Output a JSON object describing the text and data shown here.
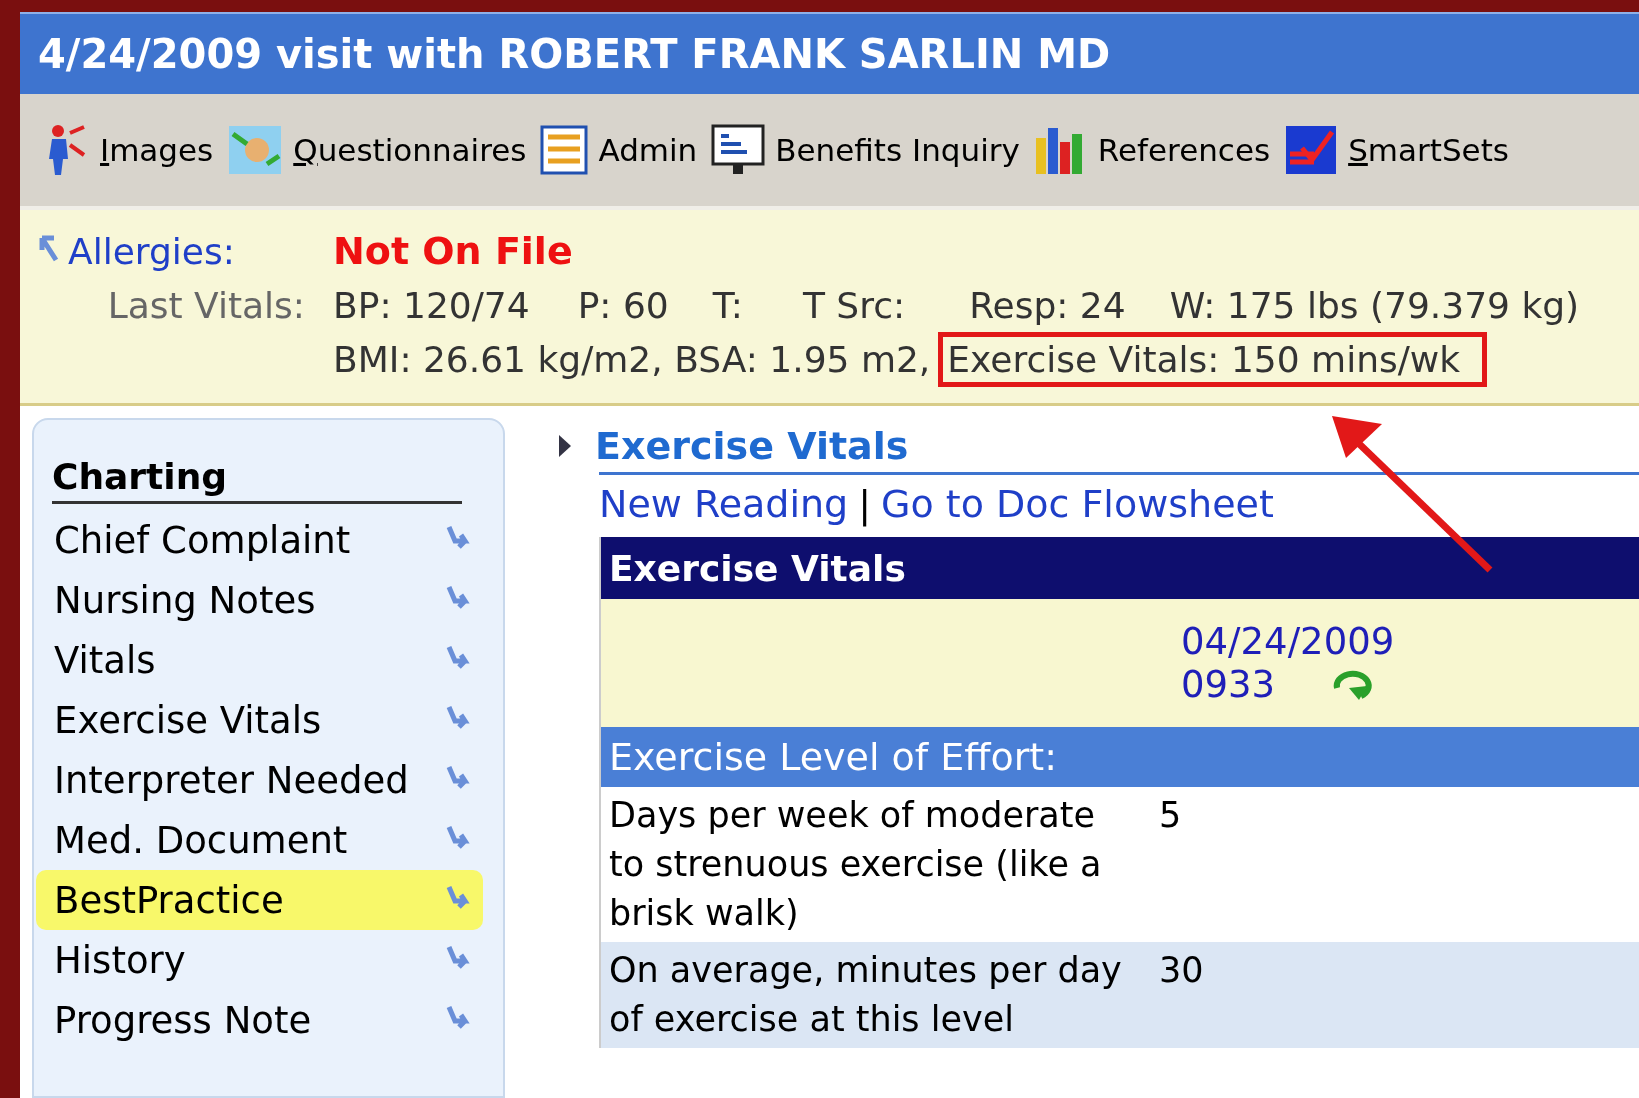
{
  "window": {
    "title": "4/24/2009 visit with ROBERT FRANK SARLIN MD"
  },
  "toolbar": [
    {
      "label": "Images",
      "kind": "person",
      "mnemonic": true
    },
    {
      "label": "Questionnaires",
      "kind": "form",
      "mnemonic": true
    },
    {
      "label": "Admin",
      "kind": "list",
      "mnemonic": false
    },
    {
      "label": "Benefits Inquiry",
      "kind": "monitor",
      "mnemonic": false
    },
    {
      "label": "References",
      "kind": "books",
      "mnemonic": false
    },
    {
      "label": "SmartSets",
      "kind": "check",
      "mnemonic": true
    }
  ],
  "header": {
    "allergies_label": "Allergies:",
    "allergies_value": "Not On File",
    "vitals_label": "Last Vitals:",
    "vitals": [
      "BP: 120/74",
      "P: 60",
      "T:",
      "T Src:",
      "Resp: 24",
      "W: 175 lbs (79.379 kg)"
    ],
    "vitals_line2": "BMI: 26.61 kg/m2, BSA: 1.95 m2,",
    "highlighted": "Exercise Vitals: 150 mins/wk"
  },
  "sidebar": {
    "heading": "Charting",
    "items": [
      {
        "label": "Chief Complaint",
        "selected": false
      },
      {
        "label": "Nursing Notes",
        "selected": false
      },
      {
        "label": "Vitals",
        "selected": false
      },
      {
        "label": "Exercise Vitals",
        "selected": false
      },
      {
        "label": "Interpreter Needed",
        "selected": false
      },
      {
        "label": "Med. Document",
        "selected": false
      },
      {
        "label": "BestPractice",
        "selected": true
      },
      {
        "label": "History",
        "selected": false
      },
      {
        "label": "Progress Note",
        "selected": false
      }
    ]
  },
  "section": {
    "title": "Exercise Vitals",
    "links": [
      "New Reading",
      "Go to Doc Flowsheet"
    ],
    "separator": "|",
    "table": {
      "title": "Exercise Vitals",
      "date": "04/24/2009",
      "time": "0933",
      "group": "Exercise Level of Effort:",
      "rows": [
        {
          "question": "Days per week of moderate to strenuous exercise (like a brisk walk)",
          "value": "5"
        },
        {
          "question": "On average, minutes per day of exercise at this level",
          "value": "30"
        }
      ]
    }
  }
}
